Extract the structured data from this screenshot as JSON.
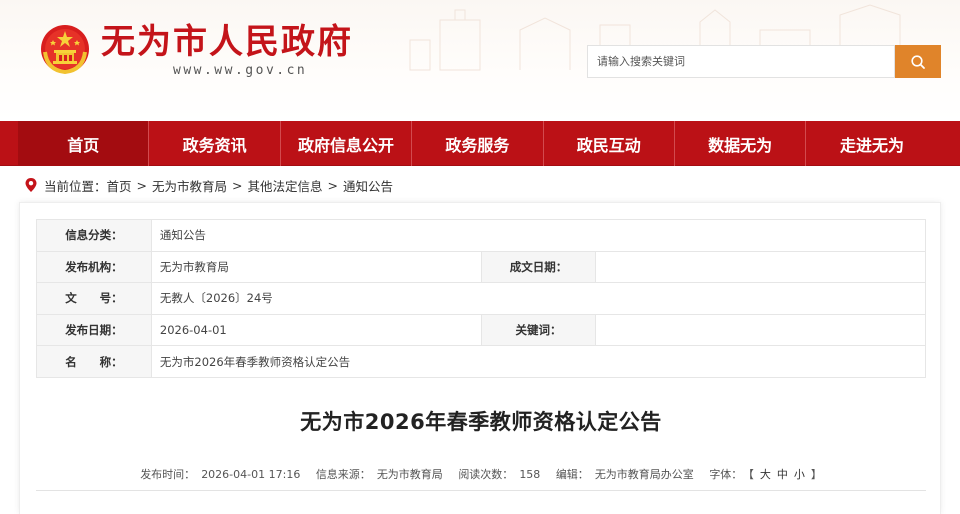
{
  "site": {
    "title": "无为市人民政府",
    "domain": "www.ww.gov.cn"
  },
  "search": {
    "placeholder": "请输入搜索关键词"
  },
  "nav": {
    "items": [
      {
        "label": "首页"
      },
      {
        "label": "政务资讯"
      },
      {
        "label": "政府信息公开"
      },
      {
        "label": "政务服务"
      },
      {
        "label": "政民互动"
      },
      {
        "label": "数据无为"
      },
      {
        "label": "走进无为"
      }
    ]
  },
  "breadcrumb": {
    "prefix": "当前位置：",
    "items": [
      "首页",
      "无为市教育局",
      "其他法定信息",
      "通知公告"
    ],
    "separator": ">"
  },
  "meta": {
    "category_label": "信息分类：",
    "category_value": "通知公告",
    "publisher_label": "发布机构：",
    "publisher_value": "无为市教育局",
    "created_label": "成文日期：",
    "created_value": "",
    "docno_label": "文　　号：",
    "docno_value": "无教人〔2026〕24号",
    "pubdate_label": "发布日期：",
    "pubdate_value": "2026-04-01",
    "keywords_label": "关键词：",
    "keywords_value": "",
    "name_label": "名　　称：",
    "name_value": "无为市2026年春季教师资格认定公告"
  },
  "article": {
    "title": "无为市2026年春季教师资格认定公告",
    "pubtime_label": "发布时间：",
    "pubtime_value": "2026-04-01 17:16",
    "source_label": "信息来源：",
    "source_value": "无为市教育局",
    "views_label": "阅读次数：",
    "views_value": "158",
    "editor_label": "编辑：",
    "editor_value": "无为市教育局办公室",
    "font_label": "字体：",
    "font_open": "【",
    "font_large": "大",
    "font_medium": "中",
    "font_small": "小",
    "font_close": "】"
  },
  "colors": {
    "brand_red": "#bb1116",
    "search_orange": "#e0842a"
  }
}
